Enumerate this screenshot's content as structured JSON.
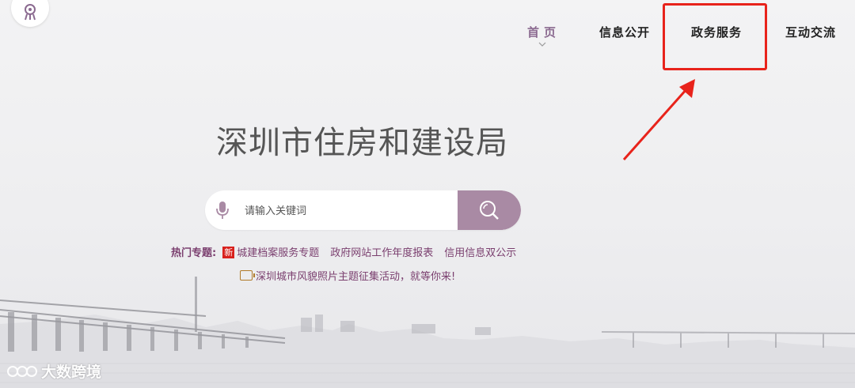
{
  "nav": {
    "items": [
      {
        "label": "首页",
        "active": true
      },
      {
        "label": "信息公开",
        "active": false
      },
      {
        "label": "政务服务",
        "active": false
      },
      {
        "label": "互动交流",
        "active": false
      }
    ]
  },
  "site_title": "深圳市住房和建设局",
  "search": {
    "placeholder": "请输入关键词",
    "value": ""
  },
  "hot_topics": {
    "label": "热门专题:",
    "new_badge": "新",
    "links": [
      "城建档案服务专题",
      "政府网站工作年度报表",
      "信用信息双公示"
    ]
  },
  "notice": "深圳城市风貌照片主题征集活动，就等你来!",
  "watermark": "大数跨境",
  "colors": {
    "accent": "#a98aa4",
    "link": "#7a3e6e",
    "annotation_red": "#e8231b"
  },
  "icons": [
    "logo-icon",
    "chevron-down-icon",
    "microphone-icon",
    "search-icon",
    "notice-icon",
    "watermark-logo-icon"
  ]
}
